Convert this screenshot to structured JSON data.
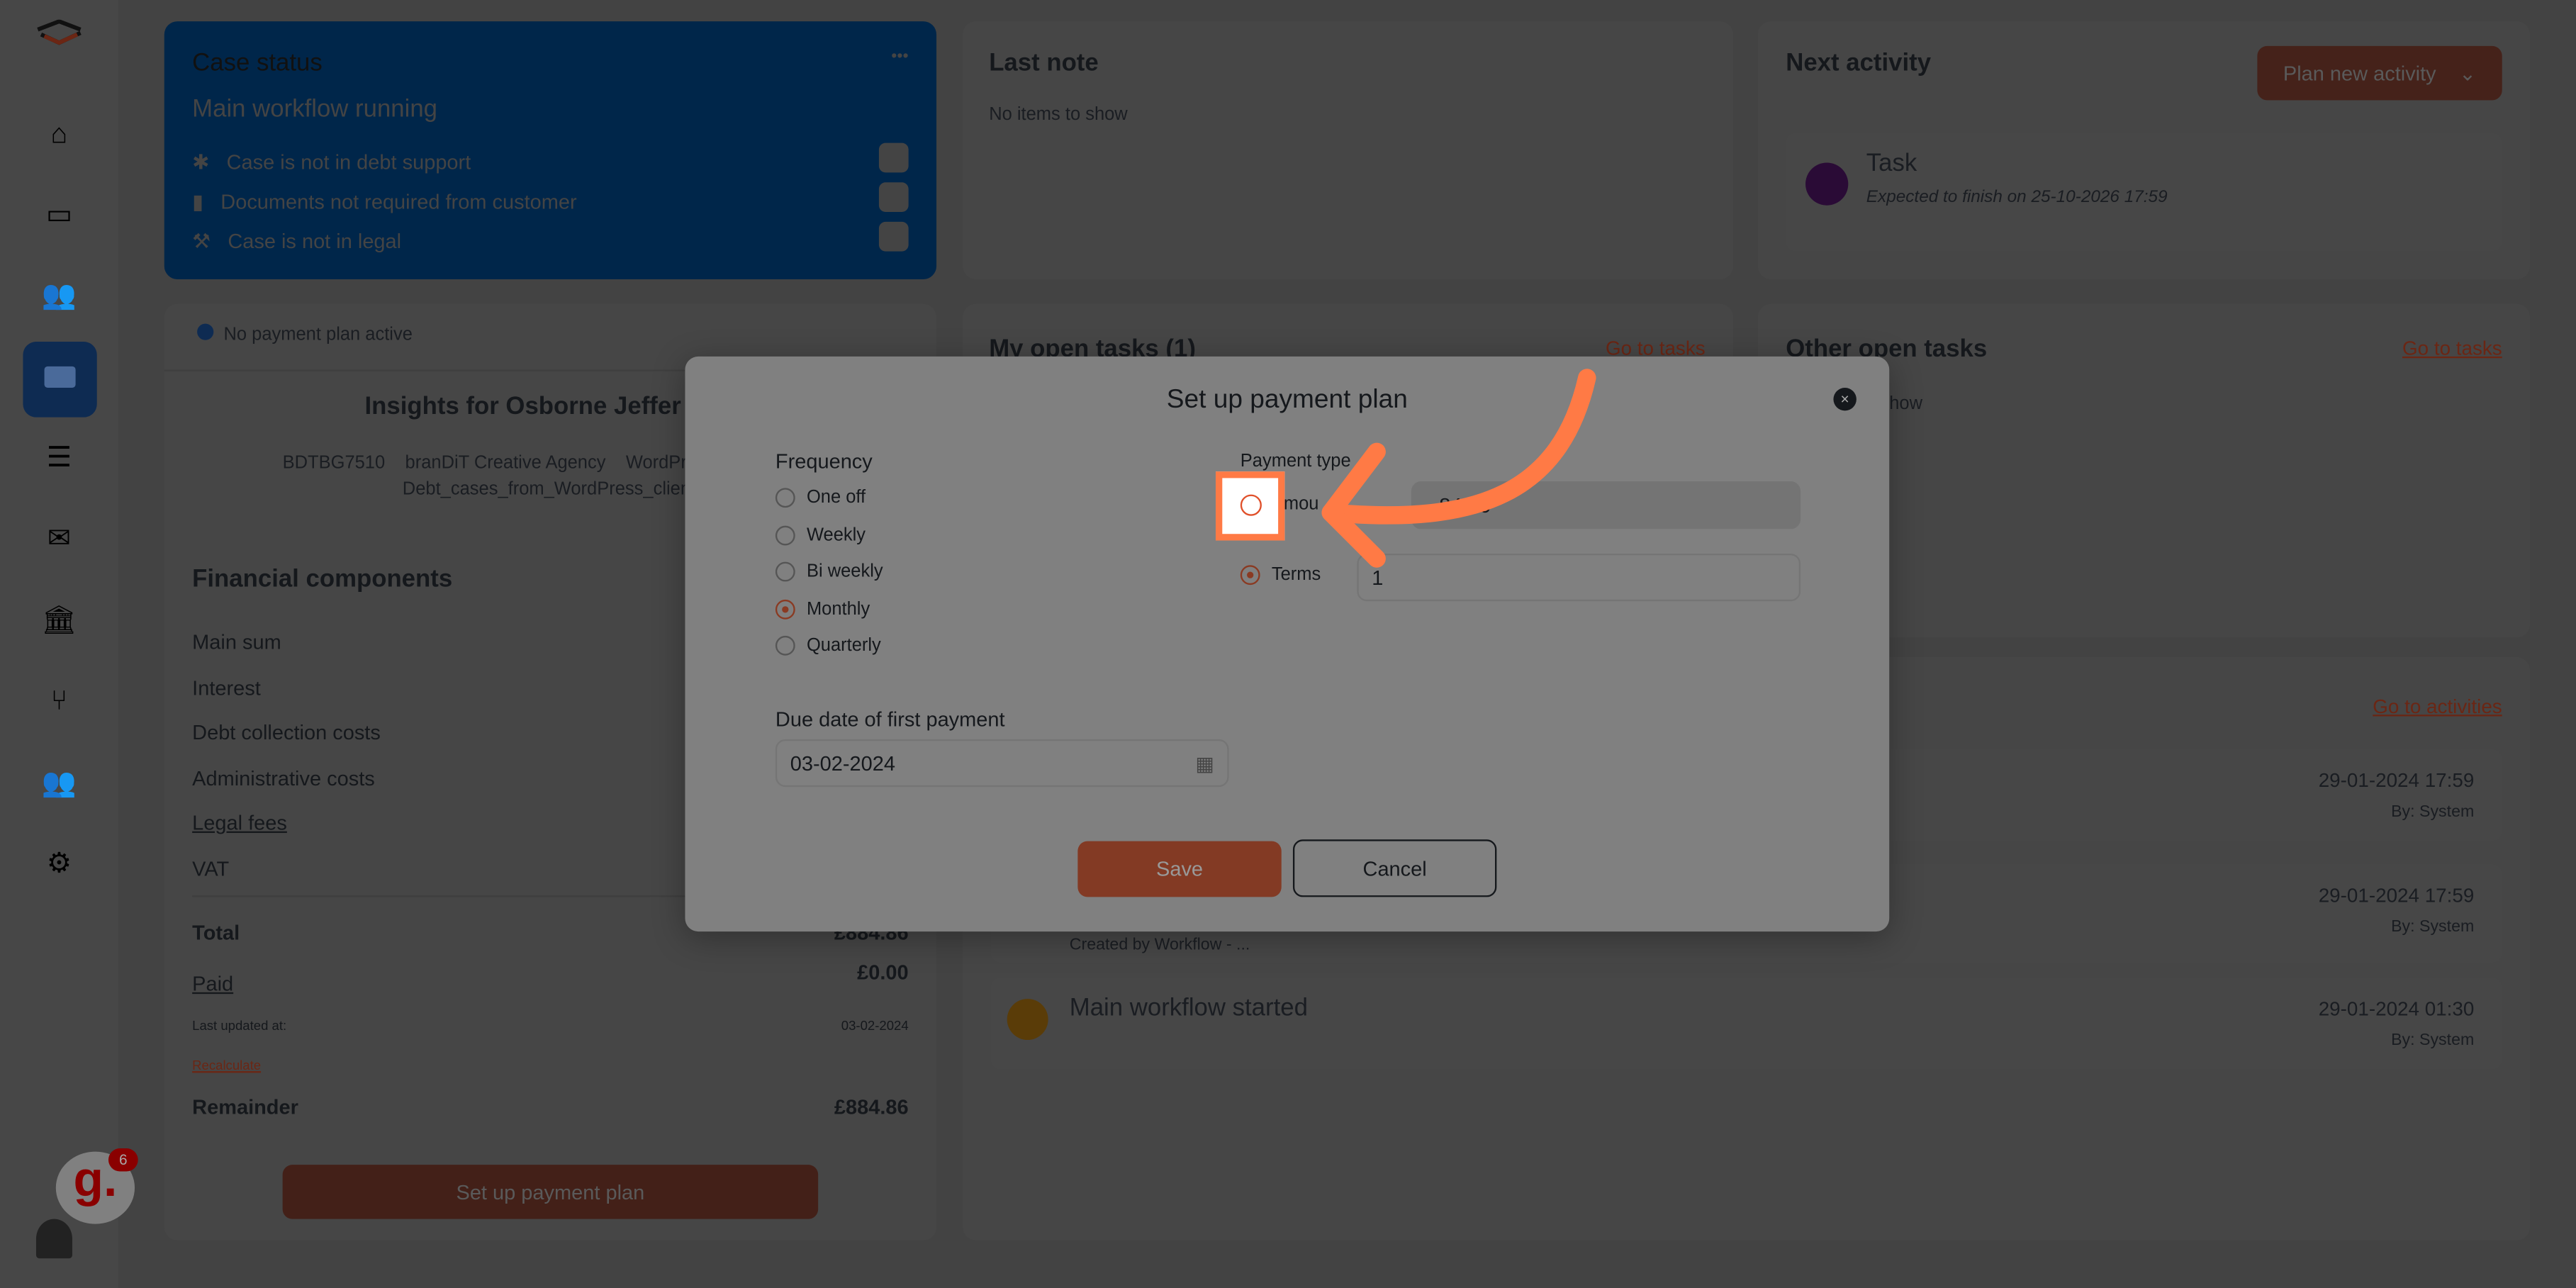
{
  "sidebar": {
    "items": [
      "logo",
      "home",
      "tickets",
      "customers",
      "cases",
      "database",
      "mail",
      "bank",
      "workflow",
      "users-settings",
      "settings"
    ],
    "active": "cases",
    "help_badge": "6",
    "help_label": "g."
  },
  "case_status": {
    "title": "Case status",
    "more": "•••",
    "workflow": "Main workflow running",
    "items": [
      {
        "icon": "asterisk-icon",
        "label": "Case is not in debt support"
      },
      {
        "icon": "file-icon",
        "label": "Documents not required from customer"
      },
      {
        "icon": "gavel-icon",
        "label": "Case is not in legal"
      }
    ],
    "color": "#00264a"
  },
  "last_note": {
    "title": "Last note",
    "empty": "No items to show"
  },
  "next_activity": {
    "title": "Next activity",
    "plan_button": "Plan new activity",
    "task_title": "Task",
    "task_subtitle": "Expected to finish on 25-10-2026 17:59"
  },
  "payment_panel": {
    "notice": "No payment plan active",
    "insights_title": "Insights for Osborne Jeffer",
    "meta1": [
      "BDTBG7510",
      "branDiT Creative Agency",
      "WordPre"
    ],
    "meta2": "Debt_cases_from_WordPress_clien",
    "fin_title": "Financial components",
    "rows": [
      "Main sum",
      "Interest",
      "Debt collection costs",
      "Administrative costs",
      "Legal fees",
      "VAT"
    ],
    "total_label": "Total",
    "total_value": "£884.86",
    "paid_label": "Paid",
    "paid_value": "£0.00",
    "updated_label": "Last updated at:",
    "updated_value": "03-02-2024",
    "recalculate": "Recalculate",
    "remainder_label": "Remainder",
    "remainder_value": "£884.86",
    "setup_button": "Set up payment plan"
  },
  "my_tasks": {
    "title": "My open tasks (1)",
    "link": "Go to tasks"
  },
  "other_tasks": {
    "title": "Other open tasks",
    "link": "Go to tasks",
    "empty": "how"
  },
  "activities": {
    "link": "Go to activities",
    "items": [
      {
        "title": "",
        "date": "29-01-2024 17:59",
        "by": "By: System"
      },
      {
        "title": "Created by Workflow - ...",
        "date": "29-01-2024 17:59",
        "by": "By: System"
      },
      {
        "title": "Main workflow started",
        "date": "29-01-2024 01:30",
        "by": "By: System"
      }
    ]
  },
  "modal": {
    "title": "Set up payment plan",
    "frequency_label": "Frequency",
    "frequencies": [
      "One off",
      "Weekly",
      "Bi weekly",
      "Monthly",
      "Quarterly"
    ],
    "frequency_selected": "Monthly",
    "payment_type_label": "Payment type",
    "amount_label": "Amou",
    "amount_value": "84,86",
    "terms_label": "Terms",
    "terms_value": "1",
    "payment_type_selected": "Terms",
    "due_label": "Due date of first payment",
    "due_value": "03-02-2024",
    "save": "Save",
    "cancel": "Cancel",
    "accent": "#8a3a22"
  },
  "annotation": {
    "color": "#ff7a45"
  }
}
